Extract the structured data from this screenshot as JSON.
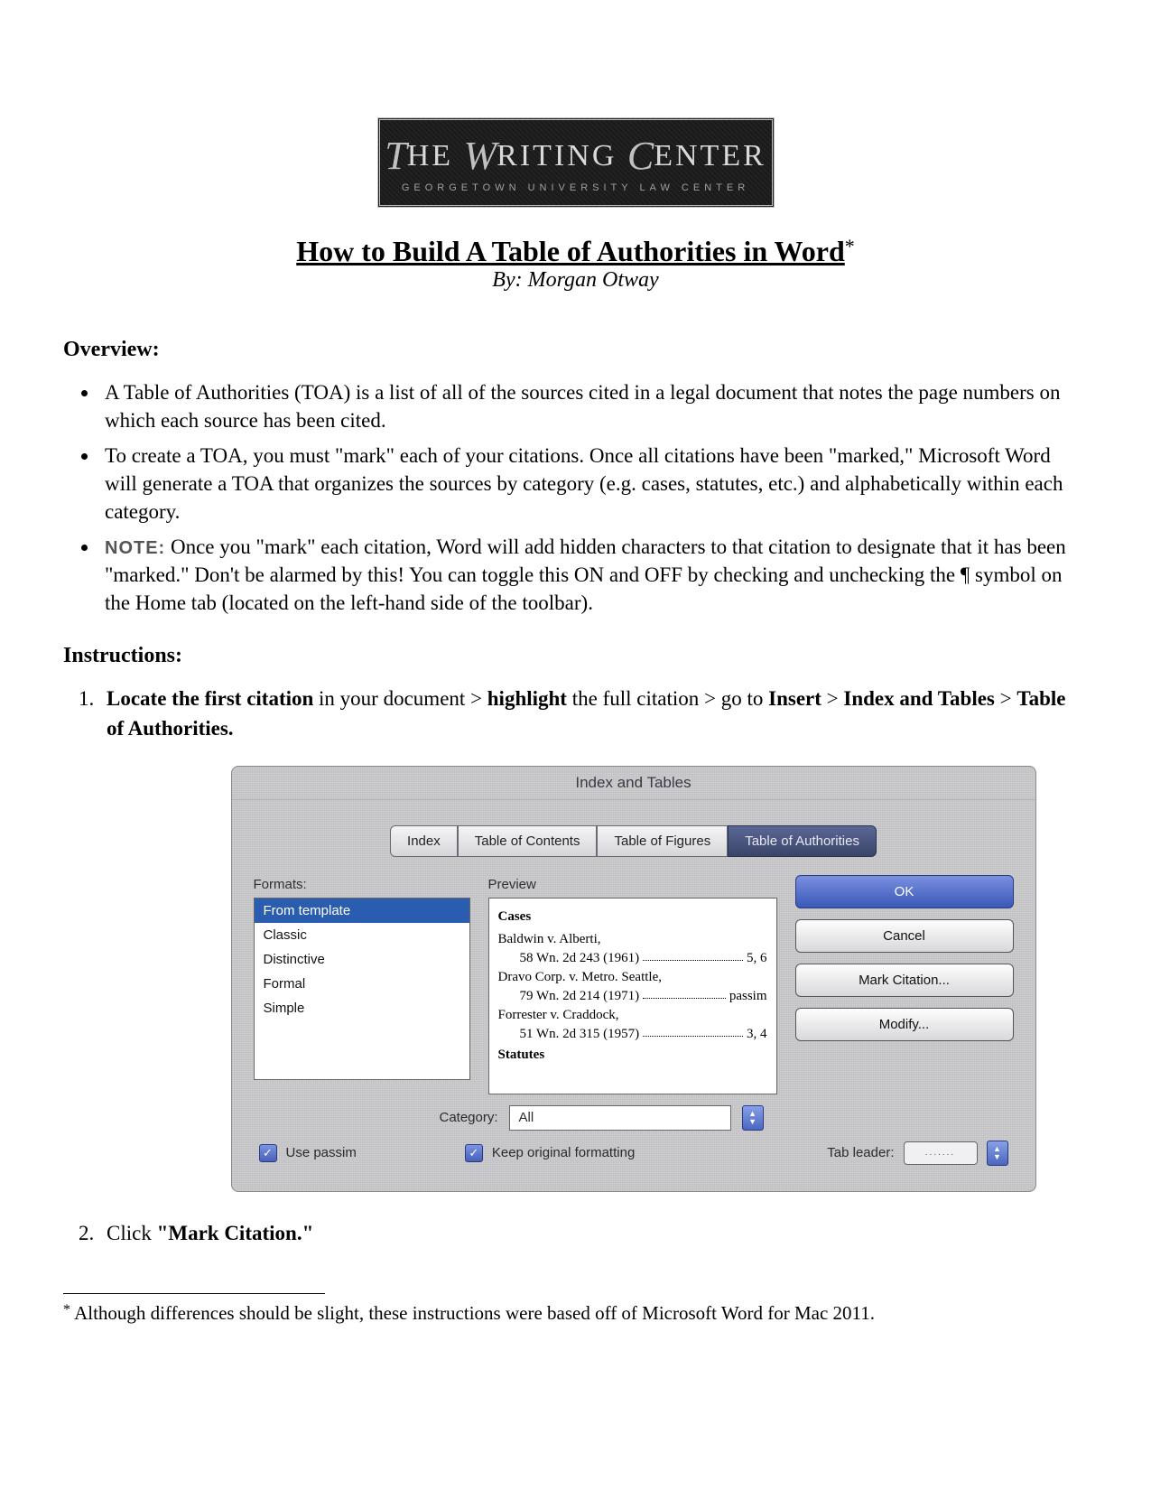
{
  "logo": {
    "main": "The Writing Center",
    "sub": "GEORGETOWN UNIVERSITY LAW CENTER"
  },
  "title": "How to Build A Table of Authorities in Word",
  "title_marker": "*",
  "byline": "By: Morgan Otway",
  "overview_heading": "Overview:",
  "overview_items": [
    "A Table of Authorities (TOA) is a list of all of the sources cited in a legal document that notes the page numbers on which each source has been cited.",
    "To create a TOA, you must \"mark\" each of your citations. Once all citations have been \"marked,\" Microsoft Word will generate a TOA that organizes the sources by category (e.g. cases, statutes, etc.) and alphabetically within each category.",
    "Once you \"mark\" each citation, Word will add hidden characters to that citation to designate that it has been \"marked.\" Don't be alarmed by this! You can toggle this ON and OFF by checking and unchecking the ¶ symbol on the Home tab (located on the left-hand side of the toolbar)."
  ],
  "note_label": "NOTE:",
  "instructions_heading": "Instructions:",
  "step1": {
    "a": "Locate the first citation",
    "b": " in your document > ",
    "c": "highlight",
    "d": " the full citation > go to ",
    "e": "Insert",
    "f": " > ",
    "g": "Index and Tables",
    "h": " > ",
    "i": "Table of Authorities."
  },
  "step2": {
    "a": "Click ",
    "b": "\"Mark Citation.\""
  },
  "dialog": {
    "title": "Index and Tables",
    "tabs": [
      "Index",
      "Table of Contents",
      "Table of Figures",
      "Table of Authorities"
    ],
    "formats_label": "Formats:",
    "formats": [
      "From template",
      "Classic",
      "Distinctive",
      "Formal",
      "Simple"
    ],
    "preview_label": "Preview",
    "preview": {
      "h1": "Cases",
      "r1a": "Baldwin v. Alberti,",
      "r1b": "58 Wn. 2d 243 (1961)",
      "r1p": "5, 6",
      "r2a": "Dravo Corp. v. Metro. Seattle,",
      "r2b": "79 Wn. 2d 214 (1971)",
      "r2p": "passim",
      "r3a": "Forrester v. Craddock,",
      "r3b": "51 Wn. 2d 315 (1957)",
      "r3p": "3, 4",
      "h2": "Statutes"
    },
    "buttons": {
      "ok": "OK",
      "cancel": "Cancel",
      "mark": "Mark Citation...",
      "modify": "Modify..."
    },
    "category_label": "Category:",
    "category_value": "All",
    "use_passim": "Use passim",
    "keep_fmt": "Keep original formatting",
    "tab_leader_label": "Tab leader:",
    "tab_leader_value": "......."
  },
  "footnote": {
    "marker": "*",
    "text": " Although differences should be slight, these instructions were based off of Microsoft Word for Mac 2011."
  }
}
